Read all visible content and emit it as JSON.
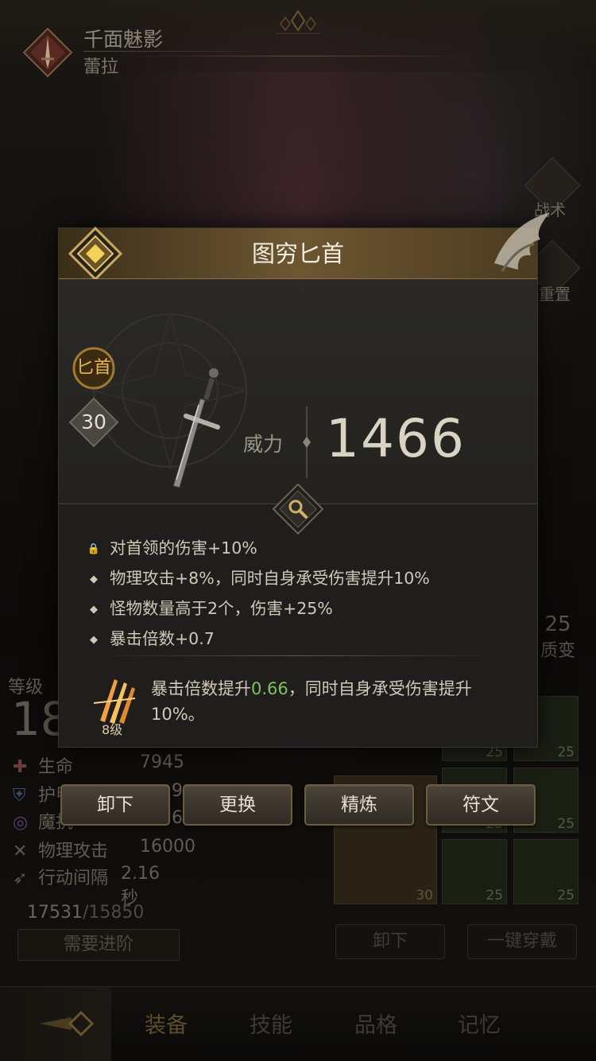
{
  "hero": {
    "title": "千面魅影",
    "name": "蕾拉"
  },
  "side_buttons": {
    "tactics_label": "战术",
    "reset_label": "重置",
    "stat_top": "25",
    "stat_bottom": "质变"
  },
  "background_panel": {
    "level_label": "等级",
    "level_value": "18",
    "stats": [
      {
        "icon": "health-icon",
        "label": "生命",
        "value": "7945"
      },
      {
        "icon": "armor-icon",
        "label": "护甲",
        "value": "9"
      },
      {
        "icon": "magic-resist-icon",
        "label": "魔抗",
        "value": "6"
      },
      {
        "icon": "attack-icon",
        "label": "物理攻击",
        "value": "16000"
      },
      {
        "icon": "speed-icon",
        "label": "行动间隔",
        "value": "2.16秒"
      }
    ],
    "exp_current": "17531",
    "exp_max": "/15850",
    "advance_button": "需要进阶",
    "unequip_button": "卸下",
    "equip_all_button": "一键穿戴",
    "slot_levels": [
      "25",
      "25",
      "25",
      "25",
      "30",
      "25",
      "25"
    ]
  },
  "modal": {
    "title": "图穷匕首",
    "weapon_type": "匕首",
    "item_level": "30",
    "power_label": "威力",
    "power_value": "1466",
    "attributes": [
      {
        "icon": "lock-icon",
        "text": "对首领的伤害+10%"
      },
      {
        "icon": "diamond-bullet-icon",
        "text": "物理攻击+8%，同时自身承受伤害提升10%"
      },
      {
        "icon": "diamond-bullet-icon",
        "text": "怪物数量高于2个，伤害+25%"
      },
      {
        "icon": "diamond-bullet-icon",
        "text": "暴击倍数+0.7"
      }
    ],
    "skill": {
      "level": "8级",
      "text_before": "暴击倍数提升",
      "highlight": "0.66",
      "text_after": "，同时自身承受伤害提升10%。",
      "highlight_color": "#7dc45a"
    }
  },
  "actions": {
    "unequip": "卸下",
    "replace": "更换",
    "refine": "精炼",
    "rune": "符文"
  },
  "bottom_nav": {
    "tabs": [
      "装备",
      "技能",
      "品格",
      "记忆"
    ],
    "active": "装备"
  },
  "colors": {
    "accent_gold": "#e9b556",
    "header_gold": "#6d5632",
    "highlight_green": "#7dc45a"
  }
}
